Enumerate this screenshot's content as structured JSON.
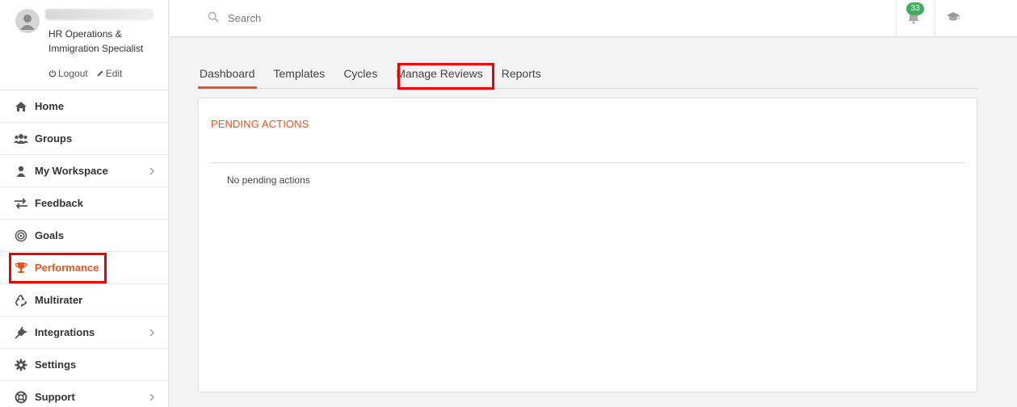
{
  "profile": {
    "role": "HR Operations & Immigration Specialist",
    "logout_label": "Logout",
    "edit_label": "Edit"
  },
  "sidebar": {
    "items": [
      {
        "label": "Home",
        "icon": "home-icon"
      },
      {
        "label": "Groups",
        "icon": "users-icon"
      },
      {
        "label": "My Workspace",
        "icon": "user-icon",
        "has_submenu": true
      },
      {
        "label": "Feedback",
        "icon": "exchange-icon"
      },
      {
        "label": "Goals",
        "icon": "target-icon"
      },
      {
        "label": "Performance",
        "icon": "trophy-icon",
        "active": true
      },
      {
        "label": "Multirater",
        "icon": "recycle-icon"
      },
      {
        "label": "Integrations",
        "icon": "plug-icon",
        "has_submenu": true
      },
      {
        "label": "Settings",
        "icon": "gear-icon"
      },
      {
        "label": "Support",
        "icon": "life-ring-icon",
        "has_submenu": true
      }
    ]
  },
  "topbar": {
    "search_placeholder": "Search",
    "notification_count": "33"
  },
  "tabs": [
    {
      "label": "Dashboard",
      "active": true
    },
    {
      "label": "Templates"
    },
    {
      "label": "Cycles"
    },
    {
      "label": "Manage Reviews"
    },
    {
      "label": "Reports"
    }
  ],
  "panel": {
    "title": "PENDING ACTIONS",
    "empty_text": "No pending actions"
  },
  "colors": {
    "accent": "#e8531f",
    "highlight": "#ee0000",
    "badge": "#3fae61"
  }
}
